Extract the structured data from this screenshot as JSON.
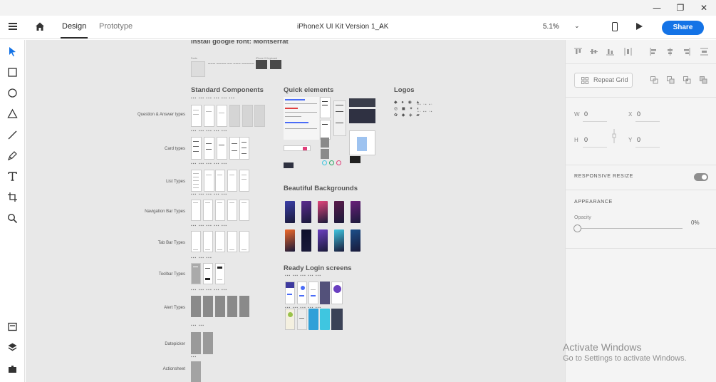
{
  "window": {
    "minimize_glyph": "—",
    "restore_glyph": "❐",
    "close_glyph": "✕"
  },
  "header": {
    "tabs": [
      {
        "label": "Design",
        "active": true
      },
      {
        "label": "Prototype",
        "active": false
      }
    ],
    "doc_title": "iPhoneX UI Kit Version 1_AK",
    "doc_chevron": "⌄",
    "zoom": "5.1%",
    "zoom_chevron": "⌄",
    "share_label": "Share",
    "share_color": "#1473e6"
  },
  "toolbar": {
    "tools": [
      "select-icon",
      "rectangle-icon",
      "ellipse-icon",
      "polygon-icon",
      "line-icon",
      "pen-icon",
      "text-icon",
      "artboard-icon",
      "zoom-icon"
    ],
    "bottom_tools": [
      "assets-icon",
      "layers-icon",
      "plugins-icon"
    ]
  },
  "canvas": {
    "font_note_heading": "Install google font: Montserrat",
    "font_note_small_left": "Fonts",
    "font_note_small_right": "iPhone X Keyboard",
    "sections": {
      "standard": "Standard Components",
      "quick": "Quick elements",
      "logos": "Logos",
      "backgrounds": "Beautiful Backgrounds",
      "login": "Ready Login screens"
    },
    "row_labels": [
      "Question & Answer types",
      "Card types",
      "List Types",
      "Navigation Bar Types",
      "Tab Bar Types",
      "Toolbar Types",
      "Alert Types",
      "Datepicker",
      "Actionsheet"
    ],
    "background_colors": [
      [
        "#3b3fa8",
        "#5b2a8f",
        "#e2457a",
        "#5a1a4a",
        "#6a1f7a"
      ],
      [
        "#f06a2a",
        "#0e0f2a",
        "#6a3fc0",
        "#3fc6e0",
        "#1b4f8a"
      ]
    ]
  },
  "panel": {
    "repeat_grid_label": "Repeat Grid",
    "w_label": "W",
    "w_value": "0",
    "h_label": "H",
    "h_value": "0",
    "x_label": "X",
    "x_value": "0",
    "y_label": "Y",
    "y_value": "0",
    "responsive_resize": "RESPONSIVE RESIZE",
    "appearance": "APPEARANCE",
    "opacity_label": "Opacity",
    "opacity_value": "0%"
  },
  "watermark": {
    "line1": "Activate Windows",
    "line2": "Go to Settings to activate Windows."
  }
}
